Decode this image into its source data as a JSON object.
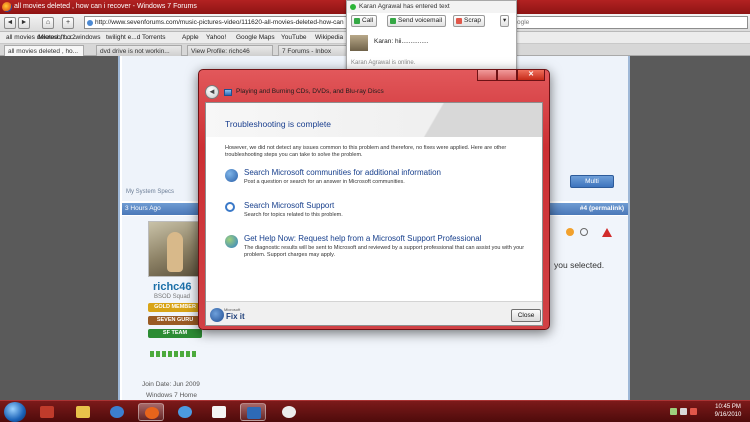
{
  "window": {
    "title": "all movies deleted , how can i recover - Windows 7 Forums"
  },
  "nav": {
    "back": "◄",
    "forward": "►",
    "home": "⌂",
    "add": "+",
    "url": "http://www.sevenforums.com/music-pictures-video/111620-all-movies-deleted-how-can",
    "search_value": "ogle"
  },
  "bookmarks": [
    "all movies deleted , ho...",
    "Microsoft...r2windows",
    "twilight e...d Torrents",
    "Apple",
    "Yahoo!",
    "Google Maps",
    "YouTube",
    "Wikipedia"
  ],
  "tabs": [
    "all movies deleted , ho...",
    "dvd drive is not workin...",
    "View Profile: richc46",
    "7 Forums - Inbox"
  ],
  "chat": {
    "header": "Karan Agrawal has entered text",
    "buttons": {
      "call": "Call",
      "voicemail": "Send voicemail",
      "scrap": "Scrap"
    },
    "message": "Karan: hii...............",
    "status": "Karan Agrawal is online."
  },
  "forum": {
    "system_specs": "My System Specs",
    "multi_button": "Multi",
    "post_time": "3 Hours Ago",
    "permalink": "#4 (permalink)",
    "username": "richc46",
    "user_title": "BSOD Squad",
    "badges": [
      {
        "label": "GOLD MEMBER",
        "color": "#d8a417"
      },
      {
        "label": "SEVEN GURU",
        "color": "#9a5b24"
      },
      {
        "label": "SF TEAM",
        "color": "#2c8c34"
      }
    ],
    "join_date": "Join Date: Jun 2009",
    "os": "Windows 7 Home",
    "post_snippet": "you selected."
  },
  "dialog": {
    "window_title": "Playing and Burning CDs, DVDs, and Blu-ray Discs",
    "heading": "Troubleshooting is complete",
    "message": "However, we did not detect any issues common to this problem and therefore, no fixes were applied. Here are other troubleshooting steps you can take to solve the problem.",
    "options": [
      {
        "title": "Search Microsoft communities for additional information",
        "desc": "Post a question or search for an answer in Microsoft communities.",
        "icon": "people-icon"
      },
      {
        "title": "Search Microsoft Support",
        "desc": "Search for topics related to this problem.",
        "icon": "magnifier-icon"
      },
      {
        "title": "Get Help Now: Request help from a Microsoft Support Professional",
        "desc": "The diagnostic results will be sent to Microsoft and reviewed by a support professional that can assist you with your problem. Support charges may apply.",
        "icon": "globe-help-icon"
      }
    ],
    "brand_small": "Microsoft",
    "brand_name": "Fix it",
    "close_button": "Close"
  },
  "taskbar": {
    "time": "10:45 PM",
    "date": "9/16/2010"
  }
}
